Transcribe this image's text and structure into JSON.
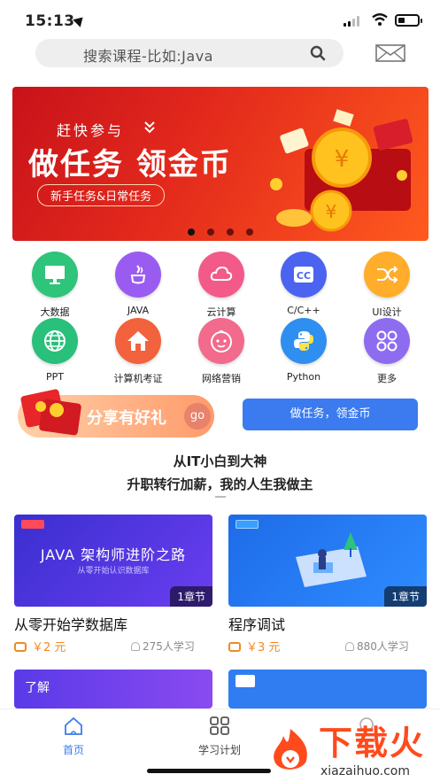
{
  "status": {
    "time": "15:13"
  },
  "search": {
    "placeholder": "搜索课程-比如:Java"
  },
  "banner": {
    "kicker": "赶快参与",
    "headline": "做任务  领金币",
    "pill": "新手任务&日常任务",
    "slide_count": 4,
    "active_slide": 1
  },
  "categories": [
    {
      "label": "大数据",
      "icon": "monitor-icon",
      "color": "#2ec47a"
    },
    {
      "label": "JAVA",
      "icon": "java-cup-icon",
      "color": "#9a5cf0"
    },
    {
      "label": "云计算",
      "icon": "cloud-icon",
      "color": "#f25a8a"
    },
    {
      "label": "C/C++",
      "icon": "cc-icon",
      "color": "#4a63f0"
    },
    {
      "label": "UI设计",
      "icon": "shuffle-icon",
      "color": "#ffad2a"
    },
    {
      "label": "PPT",
      "icon": "globe-icon",
      "color": "#28c07a"
    },
    {
      "label": "计算机考证",
      "icon": "home-icon",
      "color": "#f2623c"
    },
    {
      "label": "网络营销",
      "icon": "baby-face-icon",
      "color": "#f26a8c"
    },
    {
      "label": "Python",
      "icon": "python-icon",
      "color": "#2f8ff0"
    },
    {
      "label": "更多",
      "icon": "more-grid-icon",
      "color": "#8e6cf0"
    }
  ],
  "promo": {
    "share_label": "分享有好礼",
    "go_label": "go",
    "task_label": "做任务，领金币"
  },
  "slogan": {
    "line1": "从IT小白到大神",
    "line2": "升职转行加薪，我的人生我做主"
  },
  "courses": [
    {
      "thumb_title": "JAVA 架构师进阶之路",
      "thumb_sub": "从零开始认识数据库",
      "chapters": "1章节",
      "title": "从零开始学数据库",
      "price": "￥2 元",
      "learners": "275人学习"
    },
    {
      "thumb_title": "",
      "thumb_sub": "",
      "chapters": "1章节",
      "title": "程序调试",
      "price": "￥3 元",
      "learners": "880人学习"
    }
  ],
  "partial_cards": [
    {
      "text": "了解"
    },
    {
      "text": ""
    }
  ],
  "tabbar": {
    "items": [
      {
        "label": "首页",
        "active": true
      },
      {
        "label": "学习计划",
        "active": false
      }
    ]
  },
  "watermark": {
    "text": "下载火",
    "url": "xiazaihuo.com"
  },
  "colors": {
    "accent": "#3b7bef",
    "price": "#f08a24",
    "banner_red": "#e2281c"
  }
}
